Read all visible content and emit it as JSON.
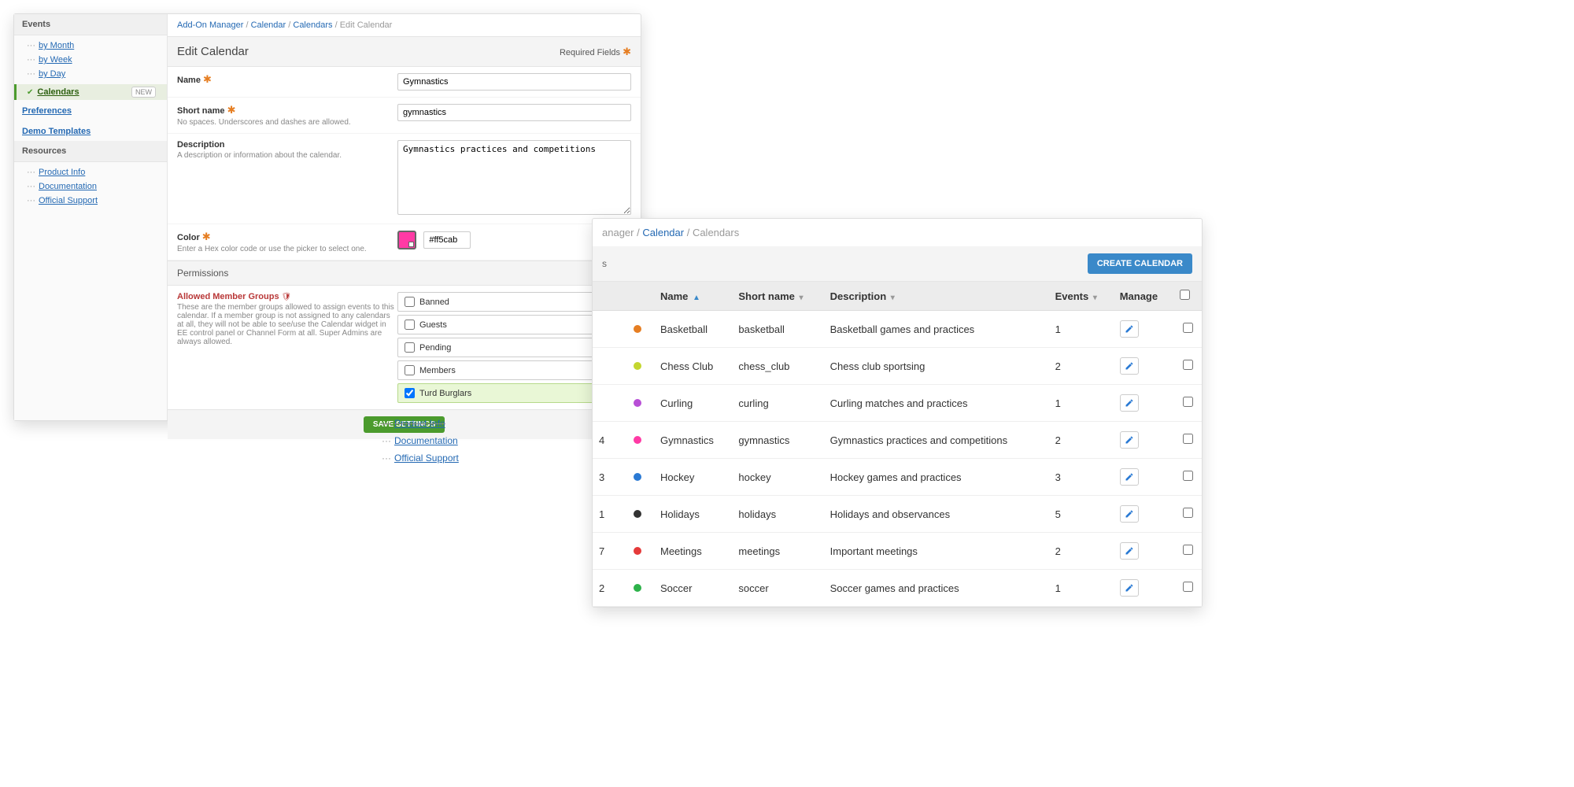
{
  "sidebar": {
    "heads": {
      "events": "Events",
      "resources": "Resources"
    },
    "events": [
      {
        "label": "by Month"
      },
      {
        "label": "by Week"
      },
      {
        "label": "by Day"
      }
    ],
    "calendars": {
      "label": "Calendars",
      "badge": "NEW"
    },
    "prefs": "Preferences",
    "demo": "Demo Templates",
    "resources": [
      {
        "label": "Product Info"
      },
      {
        "label": "Documentation"
      },
      {
        "label": "Official Support"
      }
    ]
  },
  "breadcrumb": {
    "addon": "Add-On Manager",
    "calendar": "Calendar",
    "calendars": "Calendars",
    "current": "Edit Calendar"
  },
  "form": {
    "title": "Edit Calendar",
    "required": "Required Fields",
    "name": {
      "label": "Name",
      "value": "Gymnastics"
    },
    "short": {
      "label": "Short name",
      "hint": "No spaces. Underscores and dashes are allowed.",
      "value": "gymnastics"
    },
    "desc": {
      "label": "Description",
      "hint": "A description or information about the calendar.",
      "value": "Gymnastics practices and competitions"
    },
    "color": {
      "label": "Color",
      "hint": "Enter a Hex color code or use the picker to select one.",
      "value": "#ff5cab",
      "swatch": "#ff3aa5"
    },
    "perm_head": "Permissions",
    "groups": {
      "label": "Allowed Member Groups",
      "hint": "These are the member groups allowed to assign events to this calendar. If a member group is not assigned to any calendars at all, they will not be able to see/use the Calendar widget in EE control panel or Channel Form at all. Super Admins are always allowed.",
      "items": [
        {
          "label": "Banned",
          "checked": false
        },
        {
          "label": "Guests",
          "checked": false
        },
        {
          "label": "Pending",
          "checked": false
        },
        {
          "label": "Members",
          "checked": false
        },
        {
          "label": "Turd Burglars",
          "checked": true
        }
      ]
    },
    "save": "SAVE SETTINGS"
  },
  "list": {
    "breadcrumb": {
      "manager": "anager",
      "calendar": "Calendar",
      "current": "Calendars"
    },
    "head_suffix": "s",
    "create": "CREATE CALENDAR",
    "cols": {
      "id": "",
      "name": "Name",
      "short": "Short name",
      "desc": "Description",
      "events": "Events",
      "manage": "Manage"
    },
    "rows": [
      {
        "id": "",
        "color": "#e67e22",
        "name": "Basketball",
        "short": "basketball",
        "desc": "Basketball games and practices",
        "events": "1"
      },
      {
        "id": "",
        "color": "#c3d62f",
        "name": "Chess Club",
        "short": "chess_club",
        "desc": "Chess club sportsing",
        "events": "2"
      },
      {
        "id": "",
        "color": "#b84fd6",
        "name": "Curling",
        "short": "curling",
        "desc": "Curling matches and practices",
        "events": "1"
      },
      {
        "id": "4",
        "color": "#ff3aa5",
        "name": "Gymnastics",
        "short": "gymnastics",
        "desc": "Gymnastics practices and competitions",
        "events": "2"
      },
      {
        "id": "3",
        "color": "#2a7ad4",
        "name": "Hockey",
        "short": "hockey",
        "desc": "Hockey games and practices",
        "events": "3"
      },
      {
        "id": "1",
        "color": "#333333",
        "name": "Holidays",
        "short": "holidays",
        "desc": "Holidays and observances",
        "events": "5"
      },
      {
        "id": "7",
        "color": "#e53a3a",
        "name": "Meetings",
        "short": "meetings",
        "desc": "Important meetings",
        "events": "2"
      },
      {
        "id": "2",
        "color": "#2db24a",
        "name": "Soccer",
        "short": "soccer",
        "desc": "Soccer games and practices",
        "events": "1"
      }
    ]
  },
  "floating": [
    {
      "label": "Product Info"
    },
    {
      "label": "Documentation"
    },
    {
      "label": "Official Support"
    }
  ]
}
